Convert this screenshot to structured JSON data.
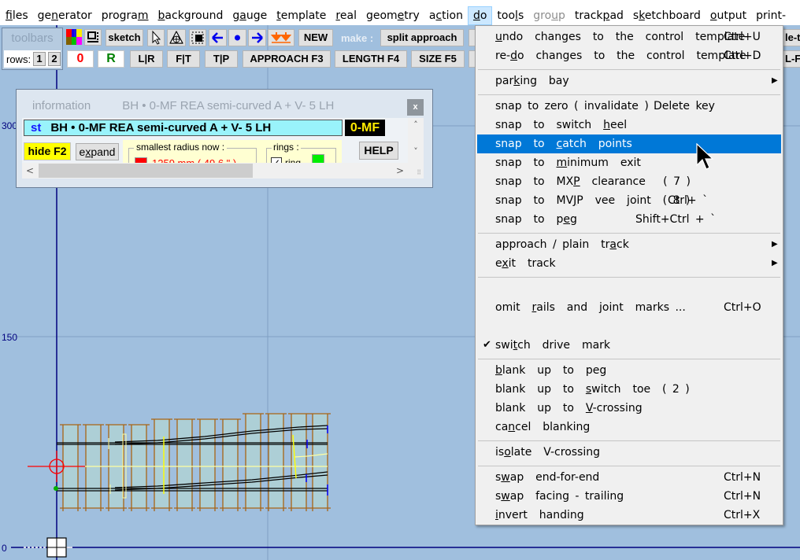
{
  "menubar": {
    "items": [
      {
        "label": "files",
        "u": 0
      },
      {
        "label": "generator",
        "u": 2
      },
      {
        "label": "program",
        "u": 6
      },
      {
        "label": "background",
        "u": 0
      },
      {
        "label": "gauge",
        "u": 1
      },
      {
        "label": "template",
        "u": 0
      },
      {
        "label": "real",
        "u": 0
      },
      {
        "label": "geometry",
        "u": 5
      },
      {
        "label": "action",
        "u": 1
      },
      {
        "label": "do",
        "u": 0,
        "active": true
      },
      {
        "label": "tools",
        "u": 3
      },
      {
        "label": "group",
        "u": 3,
        "disabled": true
      },
      {
        "label": "trackpad",
        "u": 5
      },
      {
        "label": "sketchboard",
        "u": 1
      },
      {
        "label": "output",
        "u": 0
      },
      {
        "label": "print-",
        "u": -1
      }
    ]
  },
  "toolbars": {
    "label": "toolbars",
    "rows_label": "rows:",
    "rows_buttons": [
      "1",
      "2"
    ],
    "row1": {
      "sketch": "sketch",
      "new": "NEW",
      "make_label": "make :",
      "split_approach": "split  approach",
      "right_cut": "le-t"
    },
    "row2": {
      "zero": "0",
      "r": "R",
      "lr": "L|R",
      "ft": "F|T",
      "tp": "T|P",
      "approach": "APPROACH  F3",
      "length": "LENGTH  F4",
      "size": "SIZE  F5",
      "right_cut": "L-F"
    },
    "icons": [
      "palette-icon",
      "frame-icon",
      "pointer-icon",
      "peg-icon",
      "fill-icon",
      "arrow-left-icon",
      "dot-icon",
      "arrow-right-icon",
      "double-down-icon"
    ]
  },
  "info": {
    "title": "information",
    "title_name": "BH • 0-MF  REA semi-curved  A  +  V- 5   LH",
    "close": "x",
    "prefix": "st",
    "name": "BH • 0-MF  REA semi-curved  A  +  V- 5   LH",
    "code": "0-MF",
    "hide_button": "hide  F2",
    "expand_button": "expand",
    "radius_legend": "smallest  radius  now :",
    "radius_value": "1259 mm ( 49.6 \" )",
    "rings_legend": "rings :",
    "ring_label": "ring",
    "ring_checked": true,
    "help_button": "HELP",
    "colors": {
      "name_bg": "#99f3fb",
      "code_bg": "#000000",
      "code_fg": "#ffeb00",
      "radius": "#ff0000",
      "ring": "#00ee00"
    }
  },
  "axis": {
    "y_labels": [
      "300",
      "150",
      "0"
    ]
  },
  "do_menu": {
    "items": [
      {
        "label": "undo  changes  to  the  control  template",
        "shortcut": "Ctrl+U"
      },
      {
        "label": "re-do  changes  to  the  control  template",
        "shortcut": "Ctrl+D"
      },
      {
        "label": "parking  bay",
        "submenu": true
      },
      {
        "label": "snap  to  zero  ( invalidate )",
        "shortcut": "Delete key"
      },
      {
        "label": "snap  to  switch  heel"
      },
      {
        "label": "snap  to  catch  points",
        "highlighted": true
      },
      {
        "label": "snap  to  minimum  exit"
      },
      {
        "label": "snap  to  MXP  clearance   ( 7 )"
      },
      {
        "label": "snap  to  MVJP  vee  joint  ( 8 )",
        "shortcut": "Ctrl+ `"
      },
      {
        "label": "snap  to  peg",
        "shortcut": "Shift+Ctrl + `"
      },
      {
        "label": "approach / plain  track",
        "submenu": true
      },
      {
        "label": "exit  track",
        "submenu": true
      },
      {
        "label": "omit  rails  and  joint  marks ...",
        "shortcut": "Ctrl+O"
      },
      {
        "label": "switch  drive  mark",
        "checked": true
      },
      {
        "label": "blank  up  to  peg"
      },
      {
        "label": "blank  up  to  switch  toe  ( 2 )"
      },
      {
        "label": "blank  up  to  V-crossing"
      },
      {
        "label": "cancel  blanking"
      },
      {
        "label": "isolate  V-crossing"
      },
      {
        "label": "swap  end-for-end",
        "shortcut": "Ctrl+N"
      },
      {
        "label": "swap  facing - trailing",
        "shortcut": "Ctrl+N"
      },
      {
        "label": "invert  handing",
        "shortcut": "Ctrl+X"
      }
    ],
    "highlight_color": "#0078d7"
  },
  "colors": {
    "canvas_bg": "#a0bfde",
    "sleeper": "#a86414",
    "sleeper_fill": "#adcfd6",
    "axis": "#00007f"
  }
}
